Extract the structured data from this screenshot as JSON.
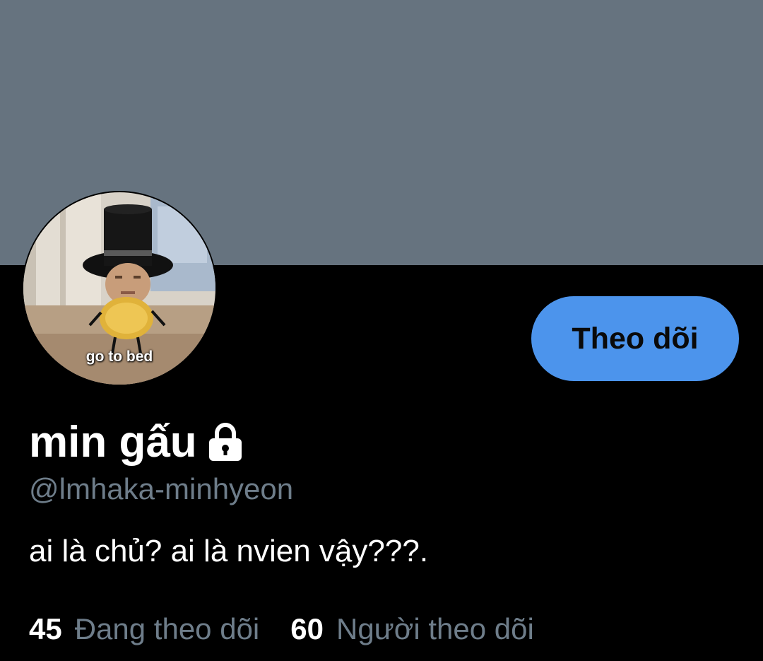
{
  "profile": {
    "display_name": "min gấu",
    "handle": "@lmhaka-minhyeon",
    "bio": "ai là chủ? ai là nvien vậy???.",
    "avatar_caption": "go to bed",
    "locked_icon": "lock-icon"
  },
  "actions": {
    "follow_label": "Theo dõi"
  },
  "stats": {
    "following": {
      "count": "45",
      "label": "Đang theo dõi"
    },
    "followers": {
      "count": "60",
      "label": "Người theo dõi"
    }
  },
  "colors": {
    "banner": "#66737f",
    "background": "#000000",
    "accent": "#4c94ec",
    "secondary_text": "#6e7d8a"
  }
}
